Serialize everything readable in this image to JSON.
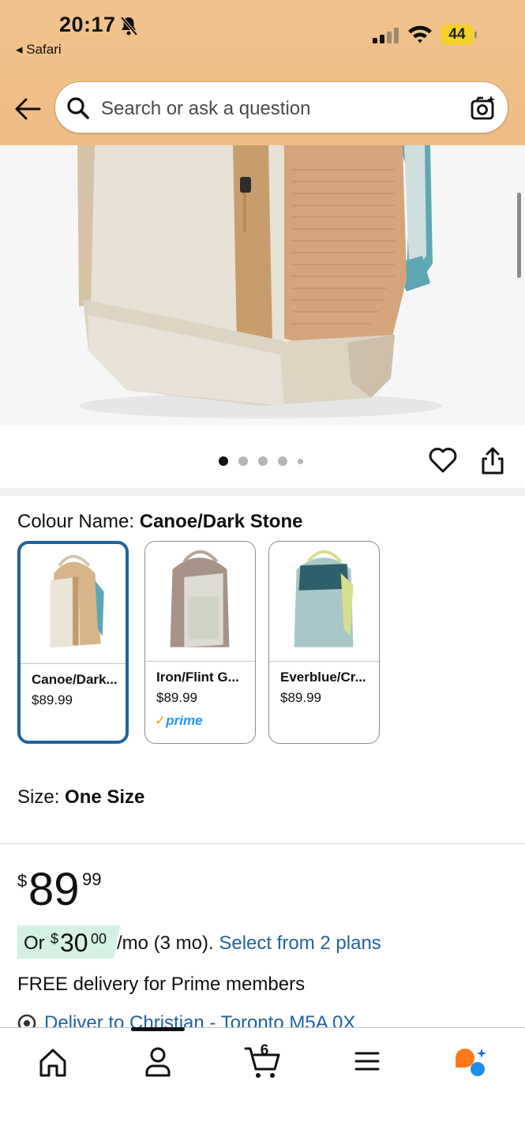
{
  "status_bar": {
    "time": "20:17",
    "back_app": "◂ Safari",
    "battery": "44"
  },
  "search": {
    "placeholder": "Search or ask a question"
  },
  "gallery": {
    "dots_count": 5,
    "active_dot": 0
  },
  "colour": {
    "label": "Colour Name: ",
    "selected": "Canoe/Dark Stone",
    "options": [
      {
        "name": "Canoe/Dark...",
        "price": "$89.99",
        "prime": "",
        "selected": true,
        "colors": [
          "#e9dfcf",
          "#d7b48a",
          "#5aa8b5"
        ]
      },
      {
        "name": "Iron/Flint G...",
        "price": "$89.99",
        "prime": "prime",
        "selected": false,
        "colors": [
          "#dcdcd3",
          "#a69388",
          "#cfd3c6"
        ]
      },
      {
        "name": "Everblue/Cr...",
        "price": "$89.99",
        "prime": "",
        "selected": false,
        "colors": [
          "#a9c7c8",
          "#2f5f6b",
          "#d6df8e"
        ]
      }
    ]
  },
  "size": {
    "label": "Size: ",
    "value": "One Size"
  },
  "price": {
    "symbol": "$",
    "whole": "89",
    "fraction": "99"
  },
  "installment": {
    "or": "Or",
    "symbol": "$",
    "amount": "30",
    "fraction": "00",
    "term": "/mo (3 mo). ",
    "link": "Select from 2 plans"
  },
  "delivery": {
    "text": "FREE delivery for Prime members",
    "deliver_to": "Deliver to Christian - Toronto M5A 0X"
  },
  "nav": {
    "cart_count": "6"
  },
  "colors": {
    "header": "#efbd84",
    "link": "#2162a1",
    "selected_border": "#2162a1",
    "installment_bg": "#d4f1e4",
    "prime_blue": "#1a98ff"
  }
}
